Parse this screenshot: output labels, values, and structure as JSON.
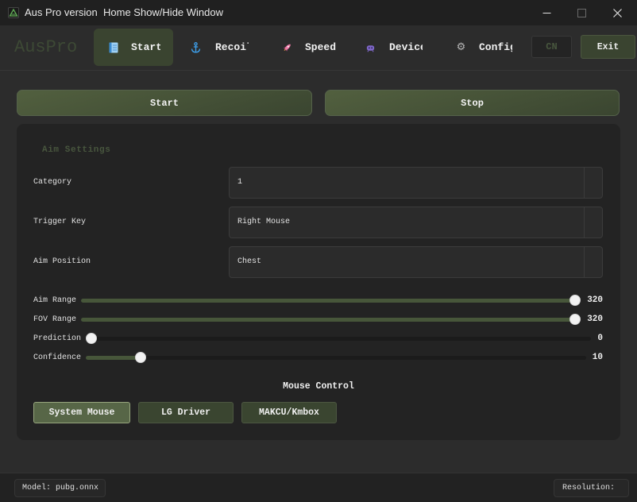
{
  "window": {
    "title": "Aus Pro version",
    "subtitle": "Home Show/Hide Window",
    "app_icon": "app-logo-icon",
    "controls": [
      "minimize-icon",
      "maximize-icon",
      "close-icon"
    ]
  },
  "header": {
    "logo": "AusPro",
    "tabs": [
      {
        "label": "Start",
        "icon": "document-icon",
        "active": true
      },
      {
        "label": "Recoil",
        "icon": "anchor-icon",
        "active": false
      },
      {
        "label": "Speed",
        "icon": "rocket-icon",
        "active": false
      },
      {
        "label": "Device",
        "icon": "game-icon",
        "active": false
      },
      {
        "label": "Config",
        "icon": "gear-icon",
        "active": false
      }
    ],
    "language_button": "CN",
    "exit_button": "Exit"
  },
  "actions": {
    "start": "Start",
    "stop": "Stop"
  },
  "aim_settings": {
    "title": "Aim Settings",
    "fields": [
      {
        "label": "Category",
        "value": "1"
      },
      {
        "label": "Trigger Key",
        "value": "Right Mouse"
      },
      {
        "label": "Aim Position",
        "value": "Chest"
      }
    ],
    "sliders": [
      {
        "label": "Aim Range",
        "value": "320",
        "level": 1.0
      },
      {
        "label": "FOV Range",
        "value": "320",
        "level": 1.0
      },
      {
        "label": "Prediction",
        "value": "0",
        "level": 0.0
      },
      {
        "label": "Confidence",
        "value": "10",
        "level": 0.1
      }
    ]
  },
  "mouse_control": {
    "title": "Mouse Control",
    "options": [
      {
        "label": "System Mouse",
        "selected": true
      },
      {
        "label": "LG Driver",
        "selected": false
      },
      {
        "label": "MAKCU/Kmbox",
        "selected": false
      }
    ]
  },
  "status_bar": {
    "model": "Model: pubg.onnx",
    "resolution": "Resolution:"
  },
  "colors": {
    "background": "#2c2c2c",
    "panel": "#232323",
    "accent": "#3a4430",
    "slider_fill": "#47563a",
    "muted_green_text": "#48563e"
  }
}
